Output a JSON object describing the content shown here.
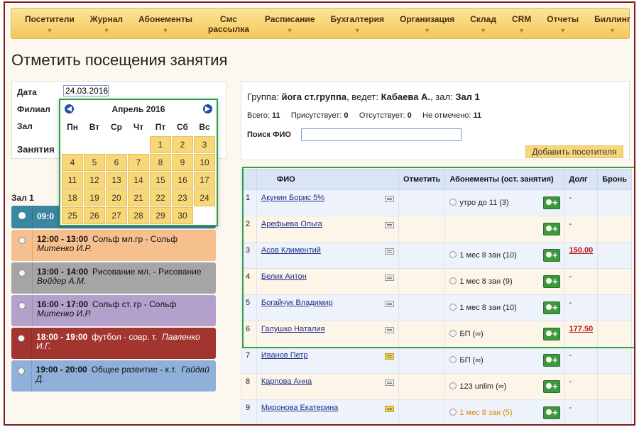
{
  "nav": [
    "Посетители",
    "Журнал",
    "Абонементы",
    "Смс рассылка",
    "Расписание",
    "Бухгалтерия",
    "Организация",
    "Склад",
    "CRM",
    "Отчеты",
    "Биллинг"
  ],
  "page_title": "Отметить посещения занятия",
  "filter": {
    "date_label": "Дата",
    "date_value": "24.03.2016",
    "branch_label": "Филиал",
    "hall_label": "Зал",
    "lessons_label": "Занятия"
  },
  "calendar": {
    "title": "Апрель 2016",
    "weekdays": [
      "Пн",
      "Вт",
      "Ср",
      "Чт",
      "Пт",
      "Сб",
      "Вс"
    ],
    "days": [
      "1",
      "2",
      "3",
      "4",
      "5",
      "6",
      "7",
      "8",
      "9",
      "10",
      "11",
      "12",
      "13",
      "14",
      "15",
      "16",
      "17",
      "18",
      "19",
      "20",
      "21",
      "22",
      "23",
      "24",
      "25",
      "26",
      "27",
      "28",
      "29",
      "30"
    ]
  },
  "hall_title": "Зал 1",
  "slots": [
    {
      "time": "09:0"
    },
    {
      "time": "12:00 - 13:00",
      "name": "Сольф мл.гр - Сольф",
      "teacher": "Митенко И.Р."
    },
    {
      "time": "13:00 - 14:00",
      "name": "Рисование мл. - Рисование",
      "teacher": "Вейдер А.М."
    },
    {
      "time": "16:00 - 17:00",
      "name": "Сольф ст. гр - Сольф",
      "teacher": "Митенко И.Р."
    },
    {
      "time": "18:00 - 19:00",
      "name": "футбол - совр. т.",
      "teacher": "Павленко И.Г."
    },
    {
      "time": "19:00 - 20:00",
      "name": "Общее развитие - к.т.",
      "teacher": "Гайдай Д."
    }
  ],
  "group": {
    "prefix": "Группа:",
    "name": "йога ст.группа",
    "led_by": ", ведет:",
    "teacher": "Кабаева А.",
    "hall_prefix": ", зал:",
    "hall": "Зал 1",
    "total_label": "Всего:",
    "total": "11",
    "present_label": "Присутствует:",
    "present": "0",
    "absent_label": "Отсутствует:",
    "absent": "0",
    "unmarked_label": "Не отмечено:",
    "unmarked": "11",
    "search_label": "Поиск ФИО",
    "add_button": "Добавить посетителя"
  },
  "table": {
    "headers": [
      "",
      "ФИО",
      "Отметить",
      "Абонементы (ост. занятия)",
      "Долг",
      "Бронь"
    ],
    "rows": [
      {
        "n": "1",
        "name": "Акунин Борис 5%",
        "sub": "утро до 11 (3)",
        "debt": "-"
      },
      {
        "n": "2",
        "name": "Арефьева Ольга",
        "sub": "",
        "debt": "-"
      },
      {
        "n": "3",
        "name": "Асов Климентий",
        "sub": "1 мес 8 зан (10)",
        "debt": "150.00"
      },
      {
        "n": "4",
        "name": "Белик Антон",
        "sub": "1 мес 8 зан (9)",
        "debt": "-"
      },
      {
        "n": "5",
        "name": "Богайчук Владимир",
        "sub": "1 мес 8 зан (10)",
        "debt": "-"
      },
      {
        "n": "6",
        "name": "Галушко Наталия",
        "sub": "БП (∞)",
        "debt": "177.50"
      },
      {
        "n": "7",
        "name": "Иванов Петр",
        "sub": "БП (∞)",
        "debt": "-"
      },
      {
        "n": "8",
        "name": "Карпова Анна",
        "sub": "123 unlim (∞)",
        "debt": "-"
      },
      {
        "n": "9",
        "name": "Миронова Екатерина",
        "sub": "1 мес 8 зан (5)",
        "debt": "-"
      }
    ]
  }
}
